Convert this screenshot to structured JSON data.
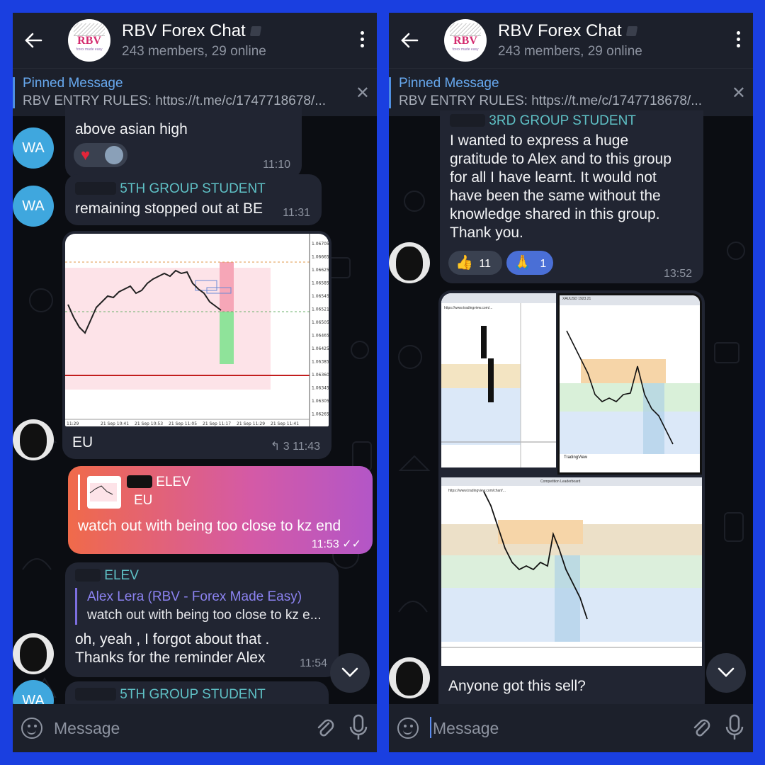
{
  "left": {
    "header": {
      "title": "RBV Forex Chat",
      "subtitle": "243 members, 29 online",
      "avatar_text": "RBV",
      "avatar_tag": "forex made easy"
    },
    "pinned": {
      "title": "Pinned Message",
      "text": "RBV ENTRY RULES: https://t.me/c/1747718678/..."
    },
    "messages": {
      "m1": {
        "text": "above asian high",
        "time": "11:10",
        "avatar": "WA"
      },
      "m2": {
        "sender": "5TH GROUP STUDENT",
        "text": "remaining stopped out at BE",
        "time": "11:31",
        "avatar": "WA"
      },
      "m3": {
        "text": "EU",
        "reply_count": "3",
        "time": "11:43"
      },
      "m4": {
        "reply_sender": "ELEV",
        "reply_text": "EU",
        "text": "watch out with being too close to kz end",
        "time": "11:53"
      },
      "m5": {
        "sender": "ELEV",
        "reply_sender": "Alex Lera (RBV - Forex Made Easy)",
        "reply_text": "watch out with being too close to kz e...",
        "text1": "oh, yeah , I forgot about that .",
        "text2": "Thanks for the reminder Alex",
        "time": "11:54"
      },
      "m6": {
        "sender": "5TH GROUP STUDENT",
        "avatar": "WA"
      }
    },
    "chart_prices": [
      "1.06705",
      "1.06665",
      "1.06625",
      "1.06585",
      "1.06545",
      "1.06521",
      "1.06505",
      "1.06465",
      "1.06425",
      "1.06385",
      "1.06360",
      "1.06345",
      "1.06305",
      "1.06265"
    ],
    "chart_times": [
      "11:29",
      "21 Sep 10:41",
      "21 Sep 10:53",
      "21 Sep 11:05",
      "21 Sep 11:17",
      "21 Sep 11:29",
      "21 Sep 11:41"
    ],
    "composer": {
      "placeholder": "Message"
    }
  },
  "right": {
    "header": {
      "title": "RBV Forex Chat",
      "subtitle": "243 members, 29 online",
      "avatar_text": "RBV",
      "avatar_tag": "forex made easy"
    },
    "pinned": {
      "title": "Pinned Message",
      "text": "RBV ENTRY RULES: https://t.me/c/1747718678/..."
    },
    "messages": {
      "m1": {
        "sender": "3RD GROUP STUDENT",
        "lines": [
          "I wanted to express a huge",
          "gratitude to Alex and to this group",
          "for all I have learnt. It would not",
          "have been the same without the",
          "knowledge shared in this group.",
          "Thank you."
        ],
        "reactions": [
          {
            "emoji": "👍",
            "count": "11"
          },
          {
            "emoji": "🙏",
            "count": "1"
          }
        ],
        "time": "13:52"
      },
      "m2": {
        "text": "Anyone got this sell?"
      }
    },
    "screenshot_labels": {
      "url_a": "https://www.tradingview.com/...",
      "url_b": "https://www.tradingview.com/chart/...",
      "tab_a": "XAUUSD 1923.21",
      "tab_b": "Competition Leaderboard",
      "brand": "TradingView"
    },
    "composer": {
      "placeholder": "Message"
    }
  },
  "colors": {
    "accent": "#1a3fe0",
    "sender_teal": "#5fc1c6",
    "link_blue": "#67a8ee"
  }
}
